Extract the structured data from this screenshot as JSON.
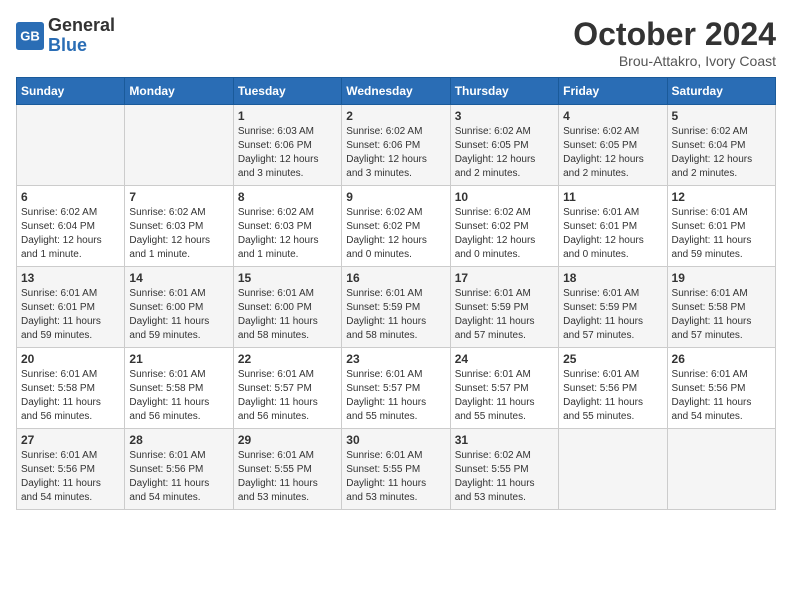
{
  "header": {
    "logo_general": "General",
    "logo_blue": "Blue",
    "month_year": "October 2024",
    "location": "Brou-Attakro, Ivory Coast"
  },
  "weekdays": [
    "Sunday",
    "Monday",
    "Tuesday",
    "Wednesday",
    "Thursday",
    "Friday",
    "Saturday"
  ],
  "weeks": [
    [
      {
        "day": "",
        "content": ""
      },
      {
        "day": "",
        "content": ""
      },
      {
        "day": "1",
        "content": "Sunrise: 6:03 AM\nSunset: 6:06 PM\nDaylight: 12 hours\nand 3 minutes."
      },
      {
        "day": "2",
        "content": "Sunrise: 6:02 AM\nSunset: 6:06 PM\nDaylight: 12 hours\nand 3 minutes."
      },
      {
        "day": "3",
        "content": "Sunrise: 6:02 AM\nSunset: 6:05 PM\nDaylight: 12 hours\nand 2 minutes."
      },
      {
        "day": "4",
        "content": "Sunrise: 6:02 AM\nSunset: 6:05 PM\nDaylight: 12 hours\nand 2 minutes."
      },
      {
        "day": "5",
        "content": "Sunrise: 6:02 AM\nSunset: 6:04 PM\nDaylight: 12 hours\nand 2 minutes."
      }
    ],
    [
      {
        "day": "6",
        "content": "Sunrise: 6:02 AM\nSunset: 6:04 PM\nDaylight: 12 hours\nand 1 minute."
      },
      {
        "day": "7",
        "content": "Sunrise: 6:02 AM\nSunset: 6:03 PM\nDaylight: 12 hours\nand 1 minute."
      },
      {
        "day": "8",
        "content": "Sunrise: 6:02 AM\nSunset: 6:03 PM\nDaylight: 12 hours\nand 1 minute."
      },
      {
        "day": "9",
        "content": "Sunrise: 6:02 AM\nSunset: 6:02 PM\nDaylight: 12 hours\nand 0 minutes."
      },
      {
        "day": "10",
        "content": "Sunrise: 6:02 AM\nSunset: 6:02 PM\nDaylight: 12 hours\nand 0 minutes."
      },
      {
        "day": "11",
        "content": "Sunrise: 6:01 AM\nSunset: 6:01 PM\nDaylight: 12 hours\nand 0 minutes."
      },
      {
        "day": "12",
        "content": "Sunrise: 6:01 AM\nSunset: 6:01 PM\nDaylight: 11 hours\nand 59 minutes."
      }
    ],
    [
      {
        "day": "13",
        "content": "Sunrise: 6:01 AM\nSunset: 6:01 PM\nDaylight: 11 hours\nand 59 minutes."
      },
      {
        "day": "14",
        "content": "Sunrise: 6:01 AM\nSunset: 6:00 PM\nDaylight: 11 hours\nand 59 minutes."
      },
      {
        "day": "15",
        "content": "Sunrise: 6:01 AM\nSunset: 6:00 PM\nDaylight: 11 hours\nand 58 minutes."
      },
      {
        "day": "16",
        "content": "Sunrise: 6:01 AM\nSunset: 5:59 PM\nDaylight: 11 hours\nand 58 minutes."
      },
      {
        "day": "17",
        "content": "Sunrise: 6:01 AM\nSunset: 5:59 PM\nDaylight: 11 hours\nand 57 minutes."
      },
      {
        "day": "18",
        "content": "Sunrise: 6:01 AM\nSunset: 5:59 PM\nDaylight: 11 hours\nand 57 minutes."
      },
      {
        "day": "19",
        "content": "Sunrise: 6:01 AM\nSunset: 5:58 PM\nDaylight: 11 hours\nand 57 minutes."
      }
    ],
    [
      {
        "day": "20",
        "content": "Sunrise: 6:01 AM\nSunset: 5:58 PM\nDaylight: 11 hours\nand 56 minutes."
      },
      {
        "day": "21",
        "content": "Sunrise: 6:01 AM\nSunset: 5:58 PM\nDaylight: 11 hours\nand 56 minutes."
      },
      {
        "day": "22",
        "content": "Sunrise: 6:01 AM\nSunset: 5:57 PM\nDaylight: 11 hours\nand 56 minutes."
      },
      {
        "day": "23",
        "content": "Sunrise: 6:01 AM\nSunset: 5:57 PM\nDaylight: 11 hours\nand 55 minutes."
      },
      {
        "day": "24",
        "content": "Sunrise: 6:01 AM\nSunset: 5:57 PM\nDaylight: 11 hours\nand 55 minutes."
      },
      {
        "day": "25",
        "content": "Sunrise: 6:01 AM\nSunset: 5:56 PM\nDaylight: 11 hours\nand 55 minutes."
      },
      {
        "day": "26",
        "content": "Sunrise: 6:01 AM\nSunset: 5:56 PM\nDaylight: 11 hours\nand 54 minutes."
      }
    ],
    [
      {
        "day": "27",
        "content": "Sunrise: 6:01 AM\nSunset: 5:56 PM\nDaylight: 11 hours\nand 54 minutes."
      },
      {
        "day": "28",
        "content": "Sunrise: 6:01 AM\nSunset: 5:56 PM\nDaylight: 11 hours\nand 54 minutes."
      },
      {
        "day": "29",
        "content": "Sunrise: 6:01 AM\nSunset: 5:55 PM\nDaylight: 11 hours\nand 53 minutes."
      },
      {
        "day": "30",
        "content": "Sunrise: 6:01 AM\nSunset: 5:55 PM\nDaylight: 11 hours\nand 53 minutes."
      },
      {
        "day": "31",
        "content": "Sunrise: 6:02 AM\nSunset: 5:55 PM\nDaylight: 11 hours\nand 53 minutes."
      },
      {
        "day": "",
        "content": ""
      },
      {
        "day": "",
        "content": ""
      }
    ]
  ]
}
